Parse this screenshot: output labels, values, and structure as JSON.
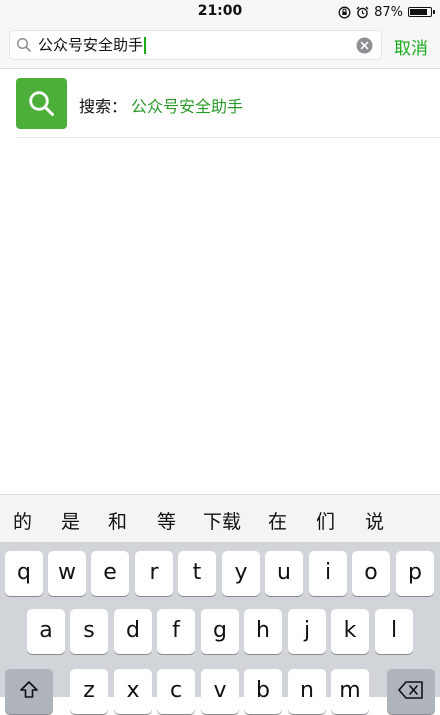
{
  "status_bar": {
    "time": "21:00",
    "battery_text": "87%",
    "battery_level": 0.87,
    "icons": [
      "orientation-lock-icon",
      "alarm-icon",
      "battery-icon"
    ]
  },
  "search": {
    "query": "公众号安全助手",
    "cancel_label": "取消"
  },
  "result": {
    "prefix": "搜索：",
    "query": "公众号安全助手",
    "accent": "#4caf3a"
  },
  "candidates": [
    "的",
    "是",
    "和",
    "等",
    "下载",
    "在",
    "们",
    "说"
  ],
  "keyboard": {
    "row1": [
      "q",
      "w",
      "e",
      "r",
      "t",
      "y",
      "u",
      "i",
      "o",
      "p"
    ],
    "row2": [
      "a",
      "s",
      "d",
      "f",
      "g",
      "h",
      "j",
      "k",
      "l"
    ],
    "row3": [
      "z",
      "x",
      "c",
      "v",
      "b",
      "n",
      "m"
    ]
  },
  "colors": {
    "brand_green": "#1aad19"
  }
}
